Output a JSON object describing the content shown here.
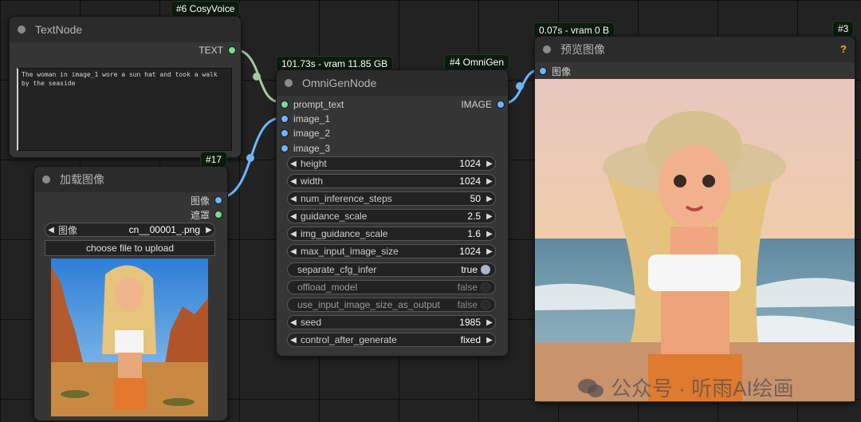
{
  "nodes": {
    "textnode": {
      "title": "TextNode",
      "badge": "#6 CosyVoice",
      "output_label": "TEXT",
      "text_value": "The woman in image_1 wore a sun hat and took a walk by the seaside"
    },
    "loadimage": {
      "title": "加载图像",
      "badge": "#17",
      "outputs": [
        "图像",
        "遮罩"
      ],
      "image_widget": {
        "label": "图像",
        "value": "cn__00001_.png"
      },
      "upload_label": "choose file to upload"
    },
    "omnigen": {
      "title": "OmniGenNode",
      "badge": "#4 OmniGen",
      "timing": "101.73s - vram 11.85 GB",
      "inputs": [
        "prompt_text",
        "image_1",
        "image_2",
        "image_3"
      ],
      "output_label": "IMAGE",
      "widgets": [
        {
          "label": "height",
          "value": "1024"
        },
        {
          "label": "width",
          "value": "1024"
        },
        {
          "label": "num_inference_steps",
          "value": "50"
        },
        {
          "label": "guidance_scale",
          "value": "2.5"
        },
        {
          "label": "img_guidance_scale",
          "value": "1.6"
        },
        {
          "label": "max_input_image_size",
          "value": "1024"
        }
      ],
      "toggles": [
        {
          "label": "separate_cfg_infer",
          "value": "true",
          "on": true
        },
        {
          "label": "offload_model",
          "value": "false",
          "on": false
        },
        {
          "label": "use_input_image_size_as_output",
          "value": "false",
          "on": false
        }
      ],
      "widgets2": [
        {
          "label": "seed",
          "value": "1985"
        },
        {
          "label": "control_after_generate",
          "value": "fixed"
        }
      ]
    },
    "preview": {
      "title": "预览图像",
      "badge": "#3",
      "timing": "0.07s - vram 0 B",
      "input_label": "图像",
      "help": "?"
    }
  },
  "watermark": "公众号 · 听雨AI绘画",
  "colors": {
    "canvas": "#222222",
    "node_body": "#353535",
    "node_title": "#2b2b2b",
    "link_green": "#a6c6a0",
    "link_blue": "#6cb6ff"
  }
}
